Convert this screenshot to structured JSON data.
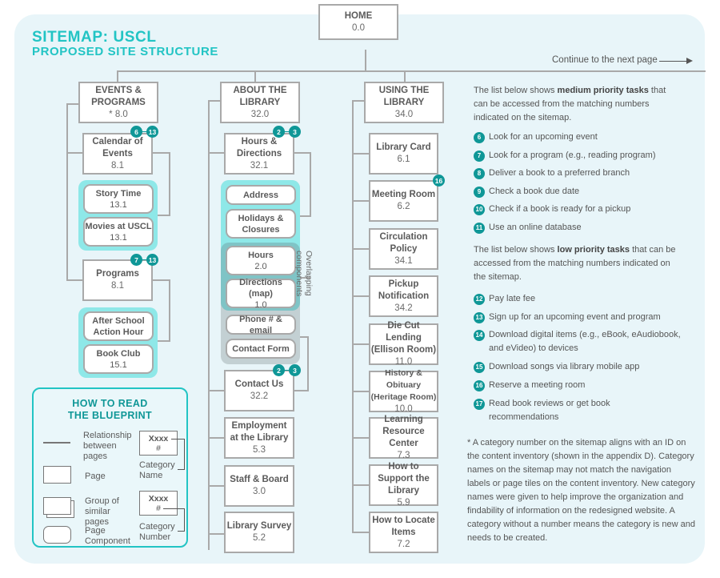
{
  "title": {
    "line1": "SITEMAP: USCL",
    "line2": "PROPOSED SITE STRUCTURE"
  },
  "continue_label": "Continue to the next page",
  "home": {
    "label": "HOME",
    "num": "0.0"
  },
  "columns": {
    "events": {
      "label": "EVENTS & PROGRAMS",
      "num": "* 8.0",
      "calendar": {
        "label": "Calendar of Events",
        "num": "8.1",
        "badges": [
          "6",
          "13"
        ]
      },
      "calendar_components": [
        {
          "label": "Story Time",
          "num": "13.1"
        },
        {
          "label": "Movies at USCL",
          "num": "13.1"
        }
      ],
      "programs": {
        "label": "Programs",
        "num": "8.1",
        "badges": [
          "7",
          "13"
        ]
      },
      "programs_components": [
        {
          "label": "After School Action Hour",
          "num": ""
        },
        {
          "label": "Book Club",
          "num": "15.1"
        }
      ]
    },
    "about": {
      "label": "ABOUT THE LIBRARY",
      "num": "32.0",
      "hours_directions": {
        "label": "Hours & Directions",
        "num": "32.1",
        "badges": [
          "2",
          "3"
        ]
      },
      "hd_components": [
        {
          "label": "Address",
          "num": ""
        },
        {
          "label": "Holidays & Closures",
          "num": ""
        }
      ],
      "overlap_components": [
        {
          "label": "Hours",
          "num": "2.0"
        },
        {
          "label": "Directions (map)",
          "num": "1.0"
        }
      ],
      "overlap_label": "Overlapping components",
      "contact_components": [
        {
          "label": "Phone # & email",
          "num": ""
        },
        {
          "label": "Contact Form",
          "num": ""
        }
      ],
      "contact": {
        "label": "Contact Us",
        "num": "32.2",
        "badges": [
          "2",
          "3"
        ]
      },
      "pages": [
        {
          "label": "Employment at the Library",
          "num": "5.3"
        },
        {
          "label": "Staff & Board",
          "num": "3.0"
        },
        {
          "label": "Library Survey",
          "num": "5.2"
        }
      ]
    },
    "using": {
      "label": "USING THE LIBRARY",
      "num": "34.0",
      "pages": [
        {
          "label": "Library Card",
          "num": "6.1",
          "badge": ""
        },
        {
          "label": "Meeting Room",
          "num": "6.2",
          "badge": "16"
        },
        {
          "label": "Circulation Policy",
          "num": "34.1",
          "badge": ""
        },
        {
          "label": "Pickup Notification",
          "num": "34.2",
          "badge": ""
        },
        {
          "label": "Die Cut Lending (Ellison Room)",
          "num": "11.0",
          "badge": ""
        },
        {
          "label": "History & Obituary (Heritage Room)",
          "num": "10.0",
          "badge": ""
        },
        {
          "label": "Learning Resource Center",
          "num": "7.3",
          "badge": ""
        },
        {
          "label": "How to Support the Library",
          "num": "5.9",
          "badge": ""
        },
        {
          "label": "How to Locate Items",
          "num": "7.2",
          "badge": ""
        }
      ]
    }
  },
  "legend": {
    "title_line1": "HOW TO READ",
    "title_line2": "THE BLUEPRINT",
    "relationship": "Relationship between pages",
    "page": "Page",
    "group": "Group of similar pages",
    "component": "Page Component",
    "sample_name": "Xxxx",
    "sample_num": "#",
    "category_name": "Category Name",
    "category_number": "Category Number"
  },
  "medium": {
    "intro_pre": "The list below shows ",
    "intro_bold": "medium priority tasks",
    "intro_post": " that can be accessed from the matching numbers indicated on the sitemap.",
    "tasks": [
      {
        "n": "6",
        "text": "Look for an upcoming event"
      },
      {
        "n": "7",
        "text": "Look for a program (e.g., reading program)"
      },
      {
        "n": "8",
        "text": "Deliver a book to a preferred branch"
      },
      {
        "n": "9",
        "text": "Check a book due date"
      },
      {
        "n": "10",
        "text": "Check if a book is ready for a pickup"
      },
      {
        "n": "11",
        "text": "Use an online database"
      }
    ]
  },
  "low": {
    "intro_pre": "The list below shows ",
    "intro_bold": "low priority tasks",
    "intro_post": " that can be accessed from the matching numbers indicated on the sitemap.",
    "tasks": [
      {
        "n": "12",
        "text": "Pay late fee"
      },
      {
        "n": "13",
        "text": "Sign up for an upcoming event and program"
      },
      {
        "n": "14",
        "text": "Download digital items (e.g., eBook, eAudiobook, and eVideo) to devices"
      },
      {
        "n": "15",
        "text": "Download songs via library mobile app"
      },
      {
        "n": "16",
        "text": "Reserve a meeting room"
      },
      {
        "n": "17",
        "text": "Read book reviews or get book recommendations"
      }
    ]
  },
  "footnote": "* A category number on the sitemap aligns with an ID on the content inventory (shown in the appendix D). Category names on the sitemap may not match the navigation labels or page tiles on the content inventory. New category names were given to help improve the organization and findability of information on the redesigned website. A category without a number means the category is new and needs to be created."
}
